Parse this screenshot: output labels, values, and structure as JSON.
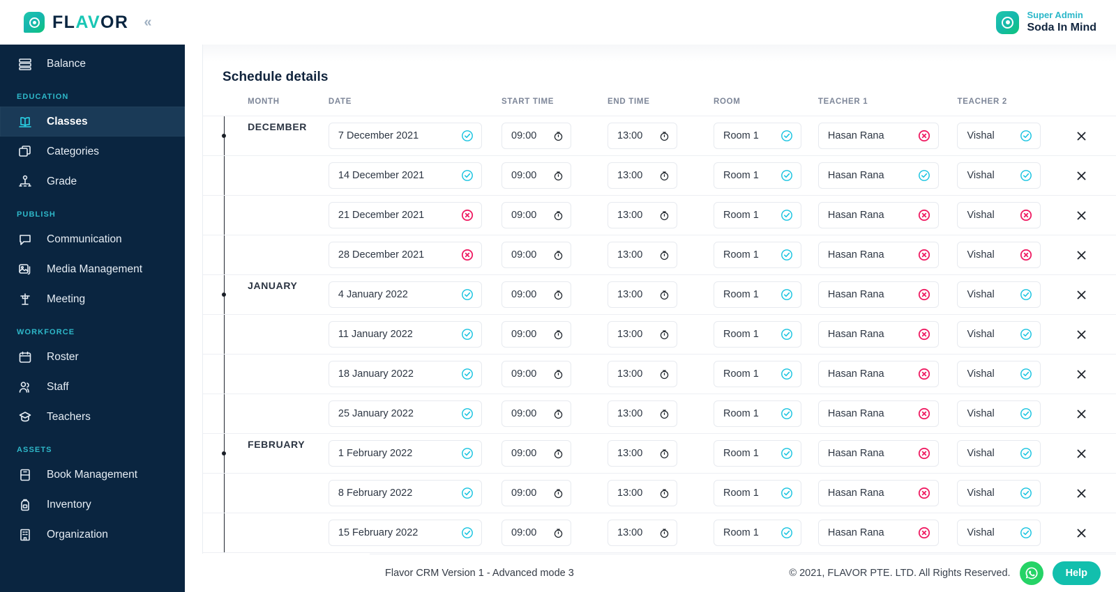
{
  "brand": {
    "name_part1": "FL",
    "name_part2": "AV",
    "name_part3": "OR",
    "collapse_label": "«"
  },
  "header": {
    "user_role": "Super Admin",
    "user_name": "Soda In Mind"
  },
  "sidebar": {
    "items": [
      {
        "label": "Balance",
        "icon": "balance-icon",
        "type": "item",
        "active": false
      },
      {
        "label": "EDUCATION",
        "icon": "",
        "type": "section",
        "active": false
      },
      {
        "label": "Classes",
        "icon": "book-icon",
        "type": "item",
        "active": true
      },
      {
        "label": "Categories",
        "icon": "layers-icon",
        "type": "item",
        "active": false
      },
      {
        "label": "Grade",
        "icon": "hierarchy-icon",
        "type": "item",
        "active": false
      },
      {
        "label": "PUBLISH",
        "icon": "",
        "type": "section",
        "active": false
      },
      {
        "label": "Communication",
        "icon": "chat-icon",
        "type": "item",
        "active": false
      },
      {
        "label": "Media Management",
        "icon": "image-icon",
        "type": "item",
        "active": false
      },
      {
        "label": "Meeting",
        "icon": "podium-icon",
        "type": "item",
        "active": false
      },
      {
        "label": "WORKFORCE",
        "icon": "",
        "type": "section",
        "active": false
      },
      {
        "label": "Roster",
        "icon": "calendar-icon",
        "type": "item",
        "active": false
      },
      {
        "label": "Staff",
        "icon": "users-icon",
        "type": "item",
        "active": false
      },
      {
        "label": "Teachers",
        "icon": "graduation-icon",
        "type": "item",
        "active": false
      },
      {
        "label": "ASSETS",
        "icon": "",
        "type": "section",
        "active": false
      },
      {
        "label": "Book Management",
        "icon": "notebook-icon",
        "type": "item",
        "active": false
      },
      {
        "label": "Inventory",
        "icon": "backpack-icon",
        "type": "item",
        "active": false
      },
      {
        "label": "Organization",
        "icon": "building-icon",
        "type": "item",
        "active": false
      }
    ]
  },
  "main": {
    "page_title": "Schedule details",
    "columns": [
      "MONTH",
      "DATE",
      "START TIME",
      "END TIME",
      "ROOM",
      "TEACHER 1",
      "TEACHER 2"
    ],
    "rows": [
      {
        "month": "DECEMBER",
        "date": "7 December 2021",
        "date_status": "valid",
        "start": "09:00",
        "end": "13:00",
        "room": "Room 1",
        "room_status": "valid",
        "teacher1": "Hasan Rana",
        "teacher1_status": "invalid",
        "teacher2": "Vishal",
        "teacher2_status": "valid"
      },
      {
        "month": "",
        "date": "14 December 2021",
        "date_status": "valid",
        "start": "09:00",
        "end": "13:00",
        "room": "Room 1",
        "room_status": "valid",
        "teacher1": "Hasan Rana",
        "teacher1_status": "valid",
        "teacher2": "Vishal",
        "teacher2_status": "valid"
      },
      {
        "month": "",
        "date": "21 December 2021",
        "date_status": "invalid",
        "start": "09:00",
        "end": "13:00",
        "room": "Room 1",
        "room_status": "valid",
        "teacher1": "Hasan Rana",
        "teacher1_status": "invalid",
        "teacher2": "Vishal",
        "teacher2_status": "invalid"
      },
      {
        "month": "",
        "date": "28 December 2021",
        "date_status": "invalid",
        "start": "09:00",
        "end": "13:00",
        "room": "Room 1",
        "room_status": "valid",
        "teacher1": "Hasan Rana",
        "teacher1_status": "invalid",
        "teacher2": "Vishal",
        "teacher2_status": "invalid"
      },
      {
        "month": "JANUARY",
        "date": "4 January 2022",
        "date_status": "valid",
        "start": "09:00",
        "end": "13:00",
        "room": "Room 1",
        "room_status": "valid",
        "teacher1": "Hasan Rana",
        "teacher1_status": "invalid",
        "teacher2": "Vishal",
        "teacher2_status": "valid"
      },
      {
        "month": "",
        "date": "11 January 2022",
        "date_status": "valid",
        "start": "09:00",
        "end": "13:00",
        "room": "Room 1",
        "room_status": "valid",
        "teacher1": "Hasan Rana",
        "teacher1_status": "invalid",
        "teacher2": "Vishal",
        "teacher2_status": "valid"
      },
      {
        "month": "",
        "date": "18 January 2022",
        "date_status": "valid",
        "start": "09:00",
        "end": "13:00",
        "room": "Room 1",
        "room_status": "valid",
        "teacher1": "Hasan Rana",
        "teacher1_status": "invalid",
        "teacher2": "Vishal",
        "teacher2_status": "valid"
      },
      {
        "month": "",
        "date": "25 January 2022",
        "date_status": "valid",
        "start": "09:00",
        "end": "13:00",
        "room": "Room 1",
        "room_status": "valid",
        "teacher1": "Hasan Rana",
        "teacher1_status": "invalid",
        "teacher2": "Vishal",
        "teacher2_status": "valid"
      },
      {
        "month": "FEBRUARY",
        "date": "1 February 2022",
        "date_status": "valid",
        "start": "09:00",
        "end": "13:00",
        "room": "Room 1",
        "room_status": "valid",
        "teacher1": "Hasan Rana",
        "teacher1_status": "invalid",
        "teacher2": "Vishal",
        "teacher2_status": "valid"
      },
      {
        "month": "",
        "date": "8 February 2022",
        "date_status": "valid",
        "start": "09:00",
        "end": "13:00",
        "room": "Room 1",
        "room_status": "valid",
        "teacher1": "Hasan Rana",
        "teacher1_status": "invalid",
        "teacher2": "Vishal",
        "teacher2_status": "valid"
      },
      {
        "month": "",
        "date": "15 February 2022",
        "date_status": "valid",
        "start": "09:00",
        "end": "13:00",
        "room": "Room 1",
        "room_status": "valid",
        "teacher1": "Hasan Rana",
        "teacher1_status": "invalid",
        "teacher2": "Vishal",
        "teacher2_status": "valid"
      }
    ]
  },
  "footer": {
    "version": "Flavor CRM Version 1 - Advanced mode 3",
    "copyright": "© 2021, FLAVOR PTE. LTD. All Rights Reserved.",
    "help_label": "Help"
  },
  "colors": {
    "sidebar_bg": "#0a2540",
    "accent_teal": "#12bfad",
    "status_valid": "#17c3e0",
    "status_invalid": "#ef1b62",
    "section_label": "#2eb8c9",
    "whatsapp_green": "#25d366"
  }
}
